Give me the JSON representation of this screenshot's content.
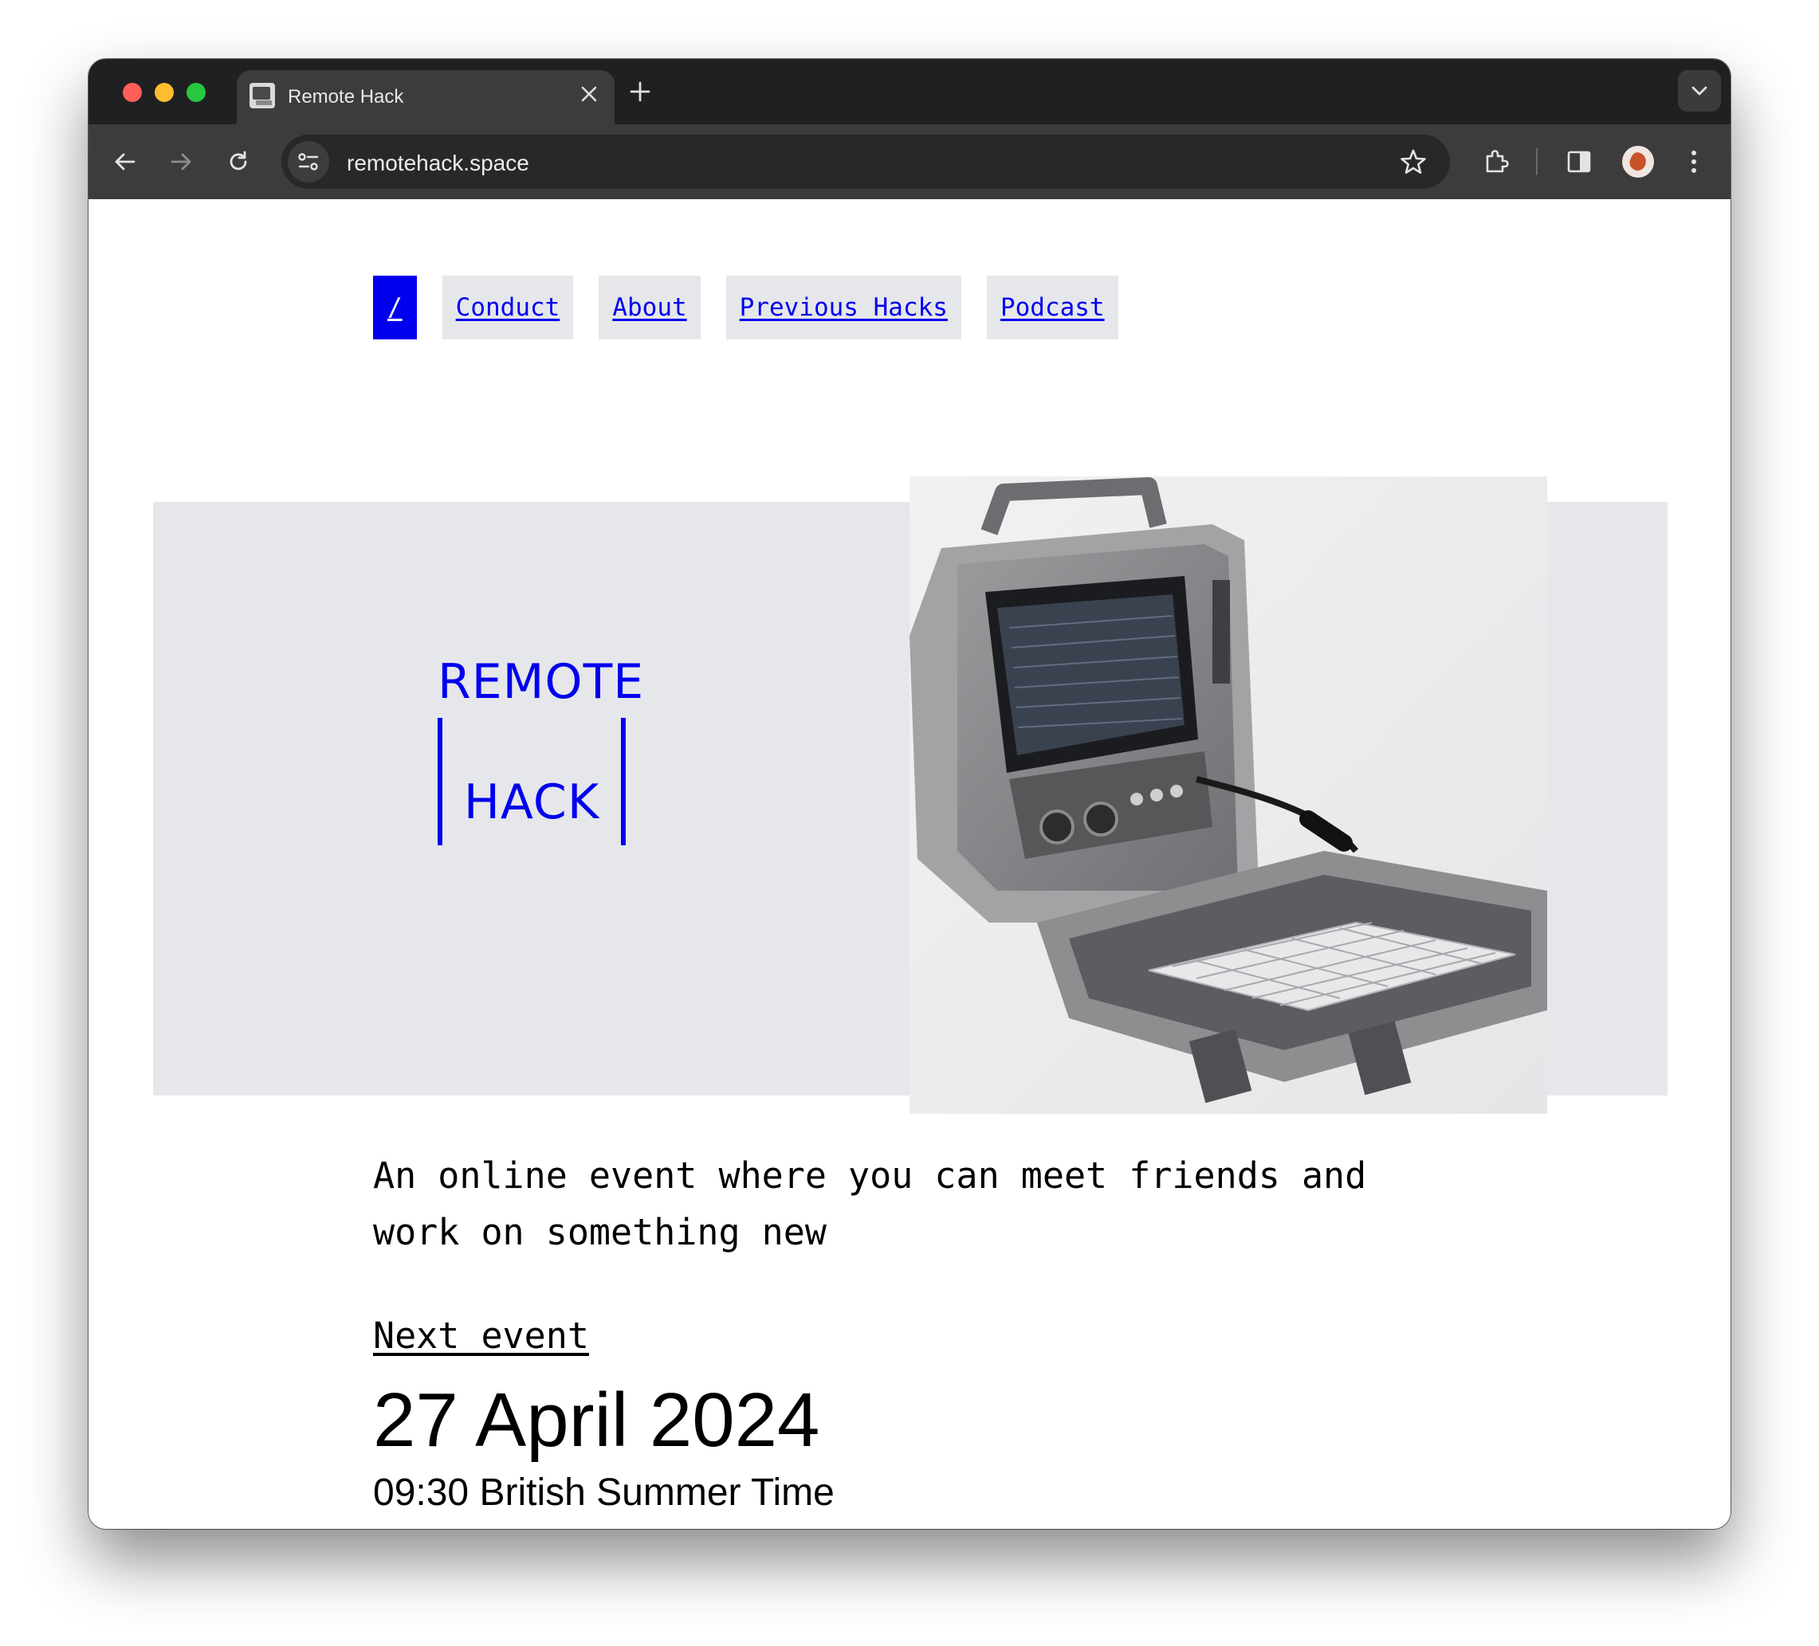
{
  "browser": {
    "tab_title": "Remote Hack",
    "tab_close_icon": "close-icon",
    "new_tab_icon": "plus-icon",
    "url": "remotehack.space",
    "colors": {
      "tabbar": "#1f2021",
      "toolbar": "#3c3c3c",
      "omnibox": "#282828"
    }
  },
  "site": {
    "nav": [
      {
        "label": "/",
        "active": true
      },
      {
        "label": "Conduct",
        "active": false
      },
      {
        "label": "About",
        "active": false
      },
      {
        "label": "Previous Hacks",
        "active": false
      },
      {
        "label": "Podcast",
        "active": false
      }
    ],
    "logo": {
      "top": "REMOTE",
      "bottom": "HACK"
    },
    "hero_image": "portable-computer-in-rugged-case",
    "tagline": "An online event where you can meet friends and work on something new",
    "next_event_label": "Next event",
    "event_date": "27 April 2024",
    "event_time": "09:30 British Summer Time",
    "colors": {
      "accent": "#0000ee",
      "nav_bg": "#e5e7eb",
      "hero_bg": "#e5e7eb",
      "text": "#000000"
    }
  }
}
